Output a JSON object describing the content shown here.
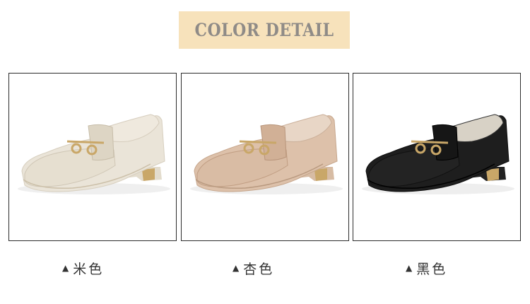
{
  "header": {
    "title": "COLOR DETAIL",
    "banner_color": "#f7e2bb",
    "title_color": "#8f8b87"
  },
  "colors": [
    {
      "label": "米色",
      "marker": "▲",
      "shoe_color": "#e8e1d3"
    },
    {
      "label": "杏色",
      "marker": "▲",
      "shoe_color": "#d9bba2"
    },
    {
      "label": "黑色",
      "marker": "▲",
      "shoe_color": "#1c1c1c"
    }
  ]
}
